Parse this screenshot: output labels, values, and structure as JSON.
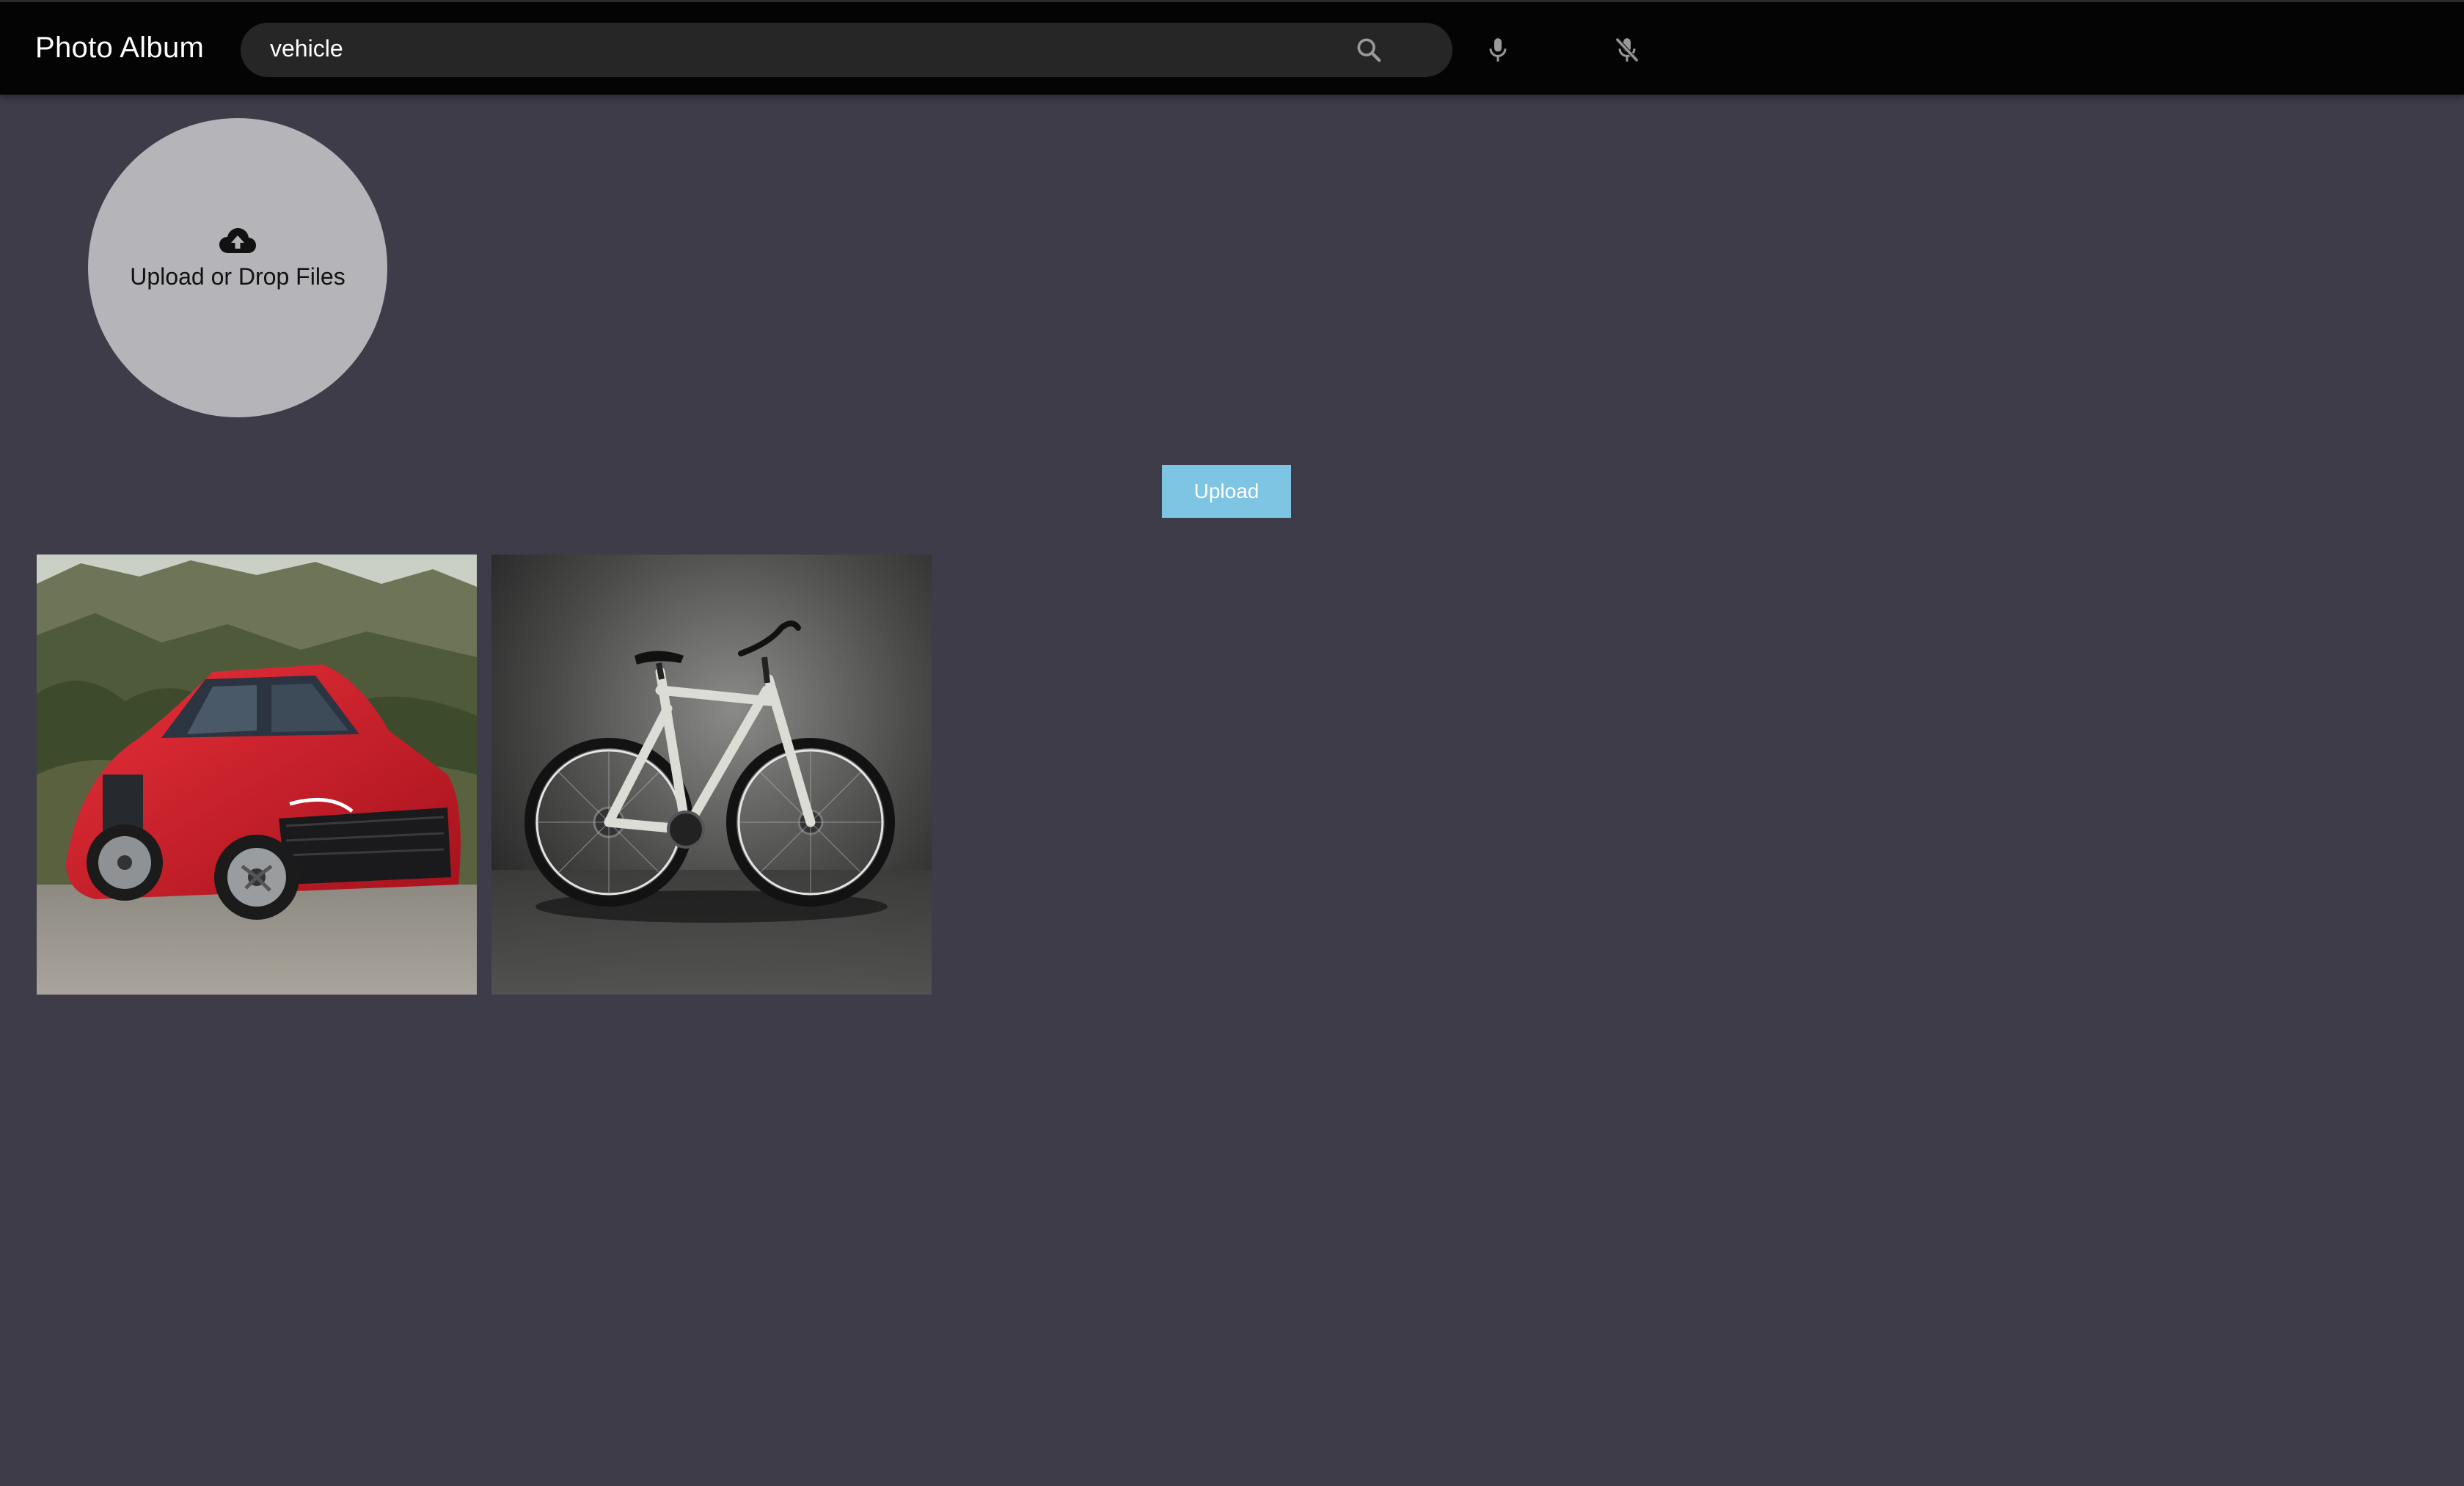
{
  "header": {
    "title": "Photo Album",
    "search": {
      "value": "vehicle",
      "placeholder": ""
    },
    "icons": [
      "search-icon",
      "microphone-icon",
      "microphone-off-icon"
    ]
  },
  "upload_zone": {
    "icon": "cloud-upload-icon",
    "label": "Upload or Drop Files"
  },
  "upload_button": {
    "label": "Upload",
    "color": "#7ec4e3"
  },
  "gallery": {
    "items": [
      {
        "subject": "car-photo"
      },
      {
        "subject": "bicycle-photo"
      }
    ]
  },
  "colors": {
    "background": "#3d3c48",
    "header": "#040404",
    "search_bar": "#262626",
    "drop_zone": "#b5b4b9"
  }
}
